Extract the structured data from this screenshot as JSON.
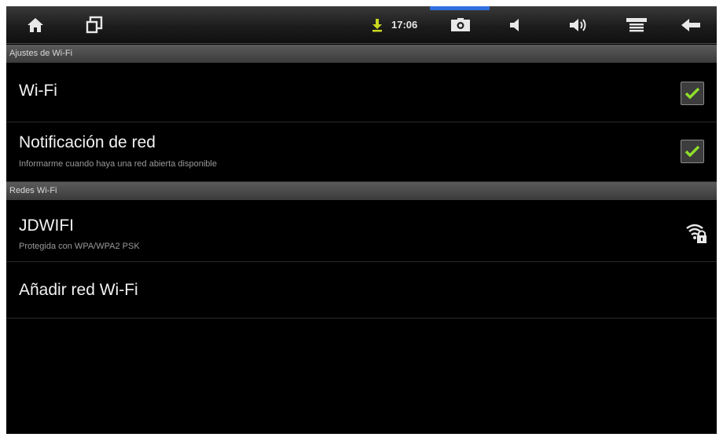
{
  "status_bar": {
    "time": "17:06",
    "icons": [
      "home-icon",
      "recent-apps-icon",
      "download-notification-icon",
      "screenshot-icon",
      "volume-down-icon",
      "volume-up-icon",
      "menu-icon",
      "back-icon"
    ]
  },
  "sections": {
    "wifi_settings_header": "Ajustes de Wi-Fi",
    "networks_header": "Redes Wi-Fi"
  },
  "wifi": {
    "title": "Wi-Fi",
    "checked": true
  },
  "network_notification": {
    "title": "Notificación de red",
    "summary": "Informarme cuando haya una red abierta disponible",
    "checked": true
  },
  "networks": [
    {
      "ssid": "JDWIFI",
      "security": "Protegida con WPA/WPA2 PSK"
    }
  ],
  "add_network": {
    "label": "Añadir red Wi-Fi"
  },
  "colors": {
    "check": "#8fe02a",
    "accent": "#2f6fe0"
  }
}
